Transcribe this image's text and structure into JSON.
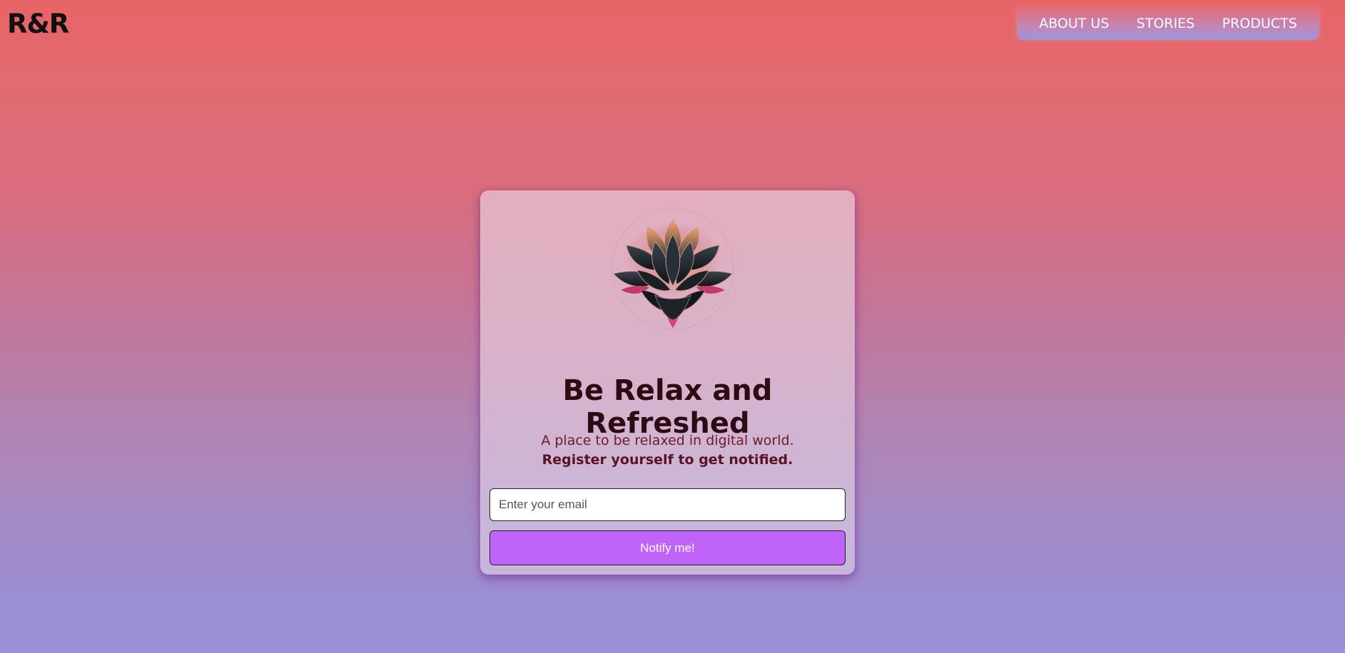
{
  "brand": {
    "logo_text": "R&R"
  },
  "nav": {
    "items": [
      {
        "label": "ABOUT US"
      },
      {
        "label": "STORIES"
      },
      {
        "label": "PRODUCTS"
      }
    ]
  },
  "card": {
    "image": "lotus-flower-illustration",
    "title": "Be Relax and Refreshed",
    "description_plain": "A place to be relaxed in digital world. ",
    "description_bold": "Register yourself to get notified.",
    "email_placeholder": "Enter your email",
    "email_value": "",
    "button_label": "Notify me!"
  },
  "colors": {
    "background_top": "#e86466",
    "background_bottom": "#9890da",
    "button": "#c063f8",
    "title_text": "#2f0a12",
    "description_text": "#6b1c2a"
  }
}
